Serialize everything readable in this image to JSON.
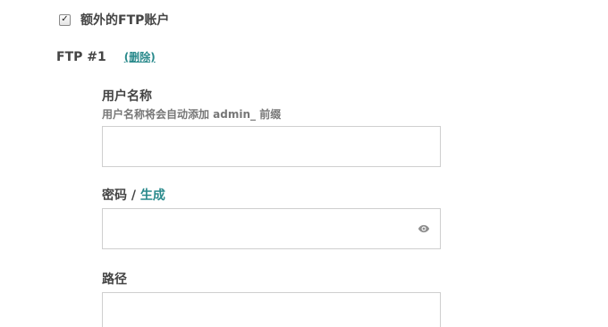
{
  "extra_ftp": {
    "checked": true,
    "label": "额外的FTP账户"
  },
  "ftp1": {
    "title": "FTP #1",
    "delete_label": "(删除)"
  },
  "username": {
    "label": "用户名称",
    "hint": "用户名称将会自动添加 admin_ 前缀",
    "value": ""
  },
  "password": {
    "label": "密码",
    "separator": " / ",
    "generate_label": "生成",
    "value": ""
  },
  "path": {
    "label": "路径",
    "value": ""
  },
  "colors": {
    "accent": "#2a8a8c",
    "text": "#444444",
    "border": "#cfcfcf"
  },
  "icons": {
    "checkbox_mark": "check-icon",
    "password_toggle": "eye-icon"
  }
}
